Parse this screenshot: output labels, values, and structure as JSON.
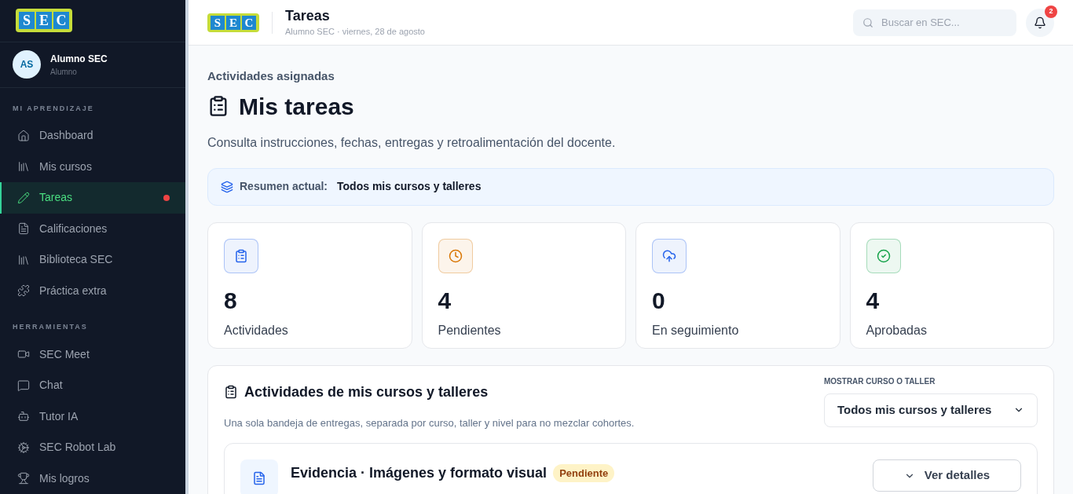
{
  "sidebar_logo": {
    "letters": [
      "S",
      "E",
      "C"
    ]
  },
  "header_logo": {
    "letters": [
      "S",
      "E",
      "C"
    ]
  },
  "user": {
    "initials": "AS",
    "name": "Alumno SEC",
    "role": "Alumno"
  },
  "sidebar": {
    "sections": [
      {
        "heading": "MI APRENDIZAJE",
        "items": [
          {
            "label": "Dashboard",
            "selected": false,
            "dot": false
          },
          {
            "label": "Mis cursos",
            "selected": false,
            "dot": false
          },
          {
            "label": "Tareas",
            "selected": true,
            "dot": true
          },
          {
            "label": "Calificaciones",
            "selected": false,
            "dot": false
          },
          {
            "label": "Biblioteca SEC",
            "selected": false,
            "dot": false
          },
          {
            "label": "Práctica extra",
            "selected": false,
            "dot": false
          }
        ]
      },
      {
        "heading": "HERRAMIENTAS",
        "items": [
          {
            "label": "SEC Meet",
            "selected": false,
            "dot": false
          },
          {
            "label": "Chat",
            "selected": false,
            "dot": false
          },
          {
            "label": "Tutor IA",
            "selected": false,
            "dot": false
          },
          {
            "label": "SEC Robot Lab",
            "selected": false,
            "dot": false
          },
          {
            "label": "Mis logros",
            "selected": false,
            "dot": false
          }
        ]
      }
    ]
  },
  "header": {
    "title": "Tareas",
    "subtitle": "Alumno SEC · viernes, 28 de agosto",
    "search": {
      "placeholder": "Buscar en SEC..."
    },
    "notifications": "2"
  },
  "page": {
    "eyebrow": "Actividades asignadas",
    "title": "Mis tareas",
    "description": "Consulta instrucciones, fechas, entregas y retroalimentación del docente.",
    "summary_label": "Resumen actual:",
    "summary_value": "Todos mis cursos y talleres"
  },
  "stats": [
    {
      "value": "8",
      "label": "Actividades",
      "color": "#2563eb"
    },
    {
      "value": "4",
      "label": "Pendientes",
      "color": "#d97706"
    },
    {
      "value": "0",
      "label": "En seguimiento",
      "color": "#2563eb"
    },
    {
      "value": "4",
      "label": "Aprobadas",
      "color": "#16a34a"
    }
  ],
  "activities": {
    "title": "Actividades de mis cursos y talleres",
    "description": "Una sola bandeja de entregas, separada por curso, taller y nivel para no mezclar cohortes.",
    "filter_label": "MOSTRAR CURSO O TALLER",
    "filter_value": "Todos mis cursos y talleres",
    "items": [
      {
        "title": "Evidencia · Imágenes y formato visual",
        "status": "Pendiente",
        "button": "Ver detalles"
      }
    ]
  }
}
